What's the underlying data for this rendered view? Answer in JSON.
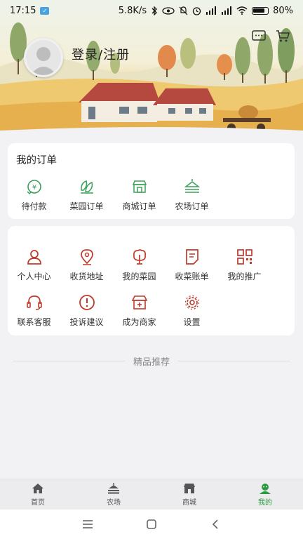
{
  "status_bar": {
    "time": "17:15",
    "network_speed": "5.8K/s",
    "battery": "80%"
  },
  "header": {
    "login_label": "登录/注册",
    "actions": [
      {
        "icon": "message-icon"
      },
      {
        "icon": "cart-icon"
      }
    ]
  },
  "orders": {
    "title": "我的订单",
    "items": [
      {
        "label": "待付款",
        "icon": "payment-pending-icon"
      },
      {
        "label": "菜园订单",
        "icon": "vegetable-order-icon"
      },
      {
        "label": "商城订单",
        "icon": "store-order-icon"
      },
      {
        "label": "农场订单",
        "icon": "farm-order-icon"
      }
    ]
  },
  "services": {
    "row1": [
      {
        "label": "个人中心",
        "icon": "person-icon"
      },
      {
        "label": "收货地址",
        "icon": "location-pin-icon"
      },
      {
        "label": "我的菜园",
        "icon": "tree-icon"
      },
      {
        "label": "收菜账单",
        "icon": "bill-icon"
      },
      {
        "label": "我的推广",
        "icon": "qrcode-icon"
      }
    ],
    "row2": [
      {
        "label": "联系客服",
        "icon": "headset-icon"
      },
      {
        "label": "投诉建议",
        "icon": "alert-icon"
      },
      {
        "label": "成为商家",
        "icon": "shop-add-icon"
      },
      {
        "label": "设置",
        "icon": "gear-icon"
      }
    ]
  },
  "recommend": {
    "title": "精品推荐"
  },
  "tabbar": {
    "items": [
      {
        "label": "首页",
        "icon": "home-icon"
      },
      {
        "label": "农场",
        "icon": "farm-icon"
      },
      {
        "label": "商城",
        "icon": "store-icon"
      },
      {
        "label": "我的",
        "icon": "profile-icon",
        "active": true
      }
    ]
  },
  "colors": {
    "order_icon_green": "#3aa05a",
    "service_icon_red": "#c0392b",
    "tab_active": "#2b9a3f",
    "tab_inactive": "#555555"
  }
}
